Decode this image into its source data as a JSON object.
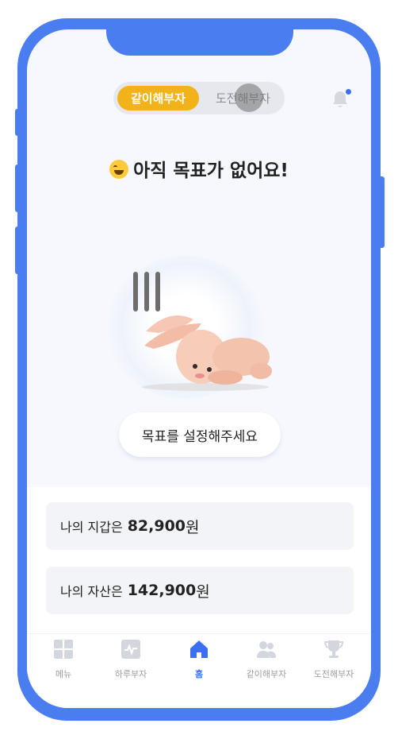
{
  "toggle": {
    "active_label": "같이해부자",
    "inactive_label": "도전해부자"
  },
  "notification": {
    "has_unread": true
  },
  "headline": "아직 목표가 없어요!",
  "cta_label": "목표를 설정해주세요",
  "wallet": {
    "prefix": "나의 지갑은",
    "amount": "82,900",
    "unit": "원"
  },
  "assets": {
    "prefix": "나의 자산은",
    "amount": "142,900",
    "unit": "원"
  },
  "tabbar": {
    "items": [
      {
        "label": "메뉴",
        "icon": "grid-icon"
      },
      {
        "label": "하루부자",
        "icon": "activity-icon"
      },
      {
        "label": "홈",
        "icon": "home-icon",
        "active": true
      },
      {
        "label": "같이해부자",
        "icon": "users-icon"
      },
      {
        "label": "도전해부자",
        "icon": "trophy-icon"
      }
    ]
  },
  "colors": {
    "accent": "#4a7ef0",
    "toggle_active": "#f1b21a",
    "tab_active": "#3b6ff0"
  }
}
